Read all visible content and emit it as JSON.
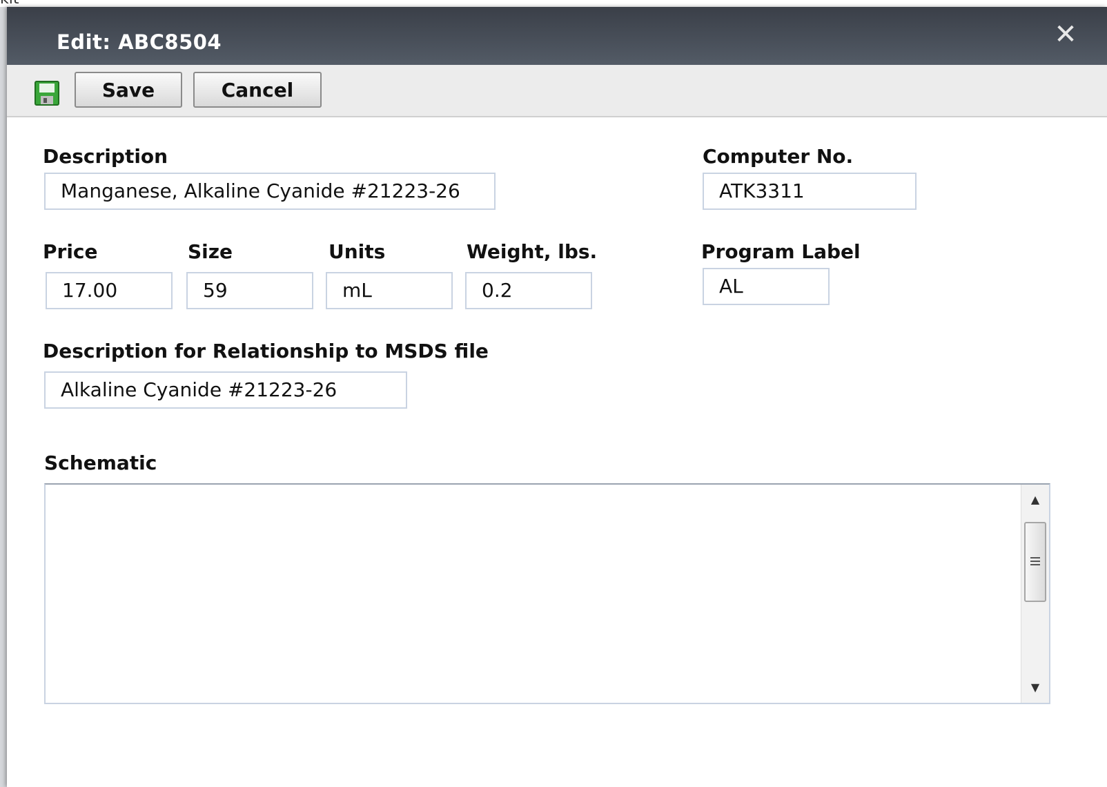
{
  "backdrop": {
    "partial_text": "kit"
  },
  "dialog": {
    "title": "Edit: ABC8504",
    "close_glyph": "✕"
  },
  "toolbar": {
    "save_icon": "floppy-disk-icon",
    "save_label": "Save",
    "cancel_label": "Cancel"
  },
  "form": {
    "description": {
      "label": "Description",
      "value": "Manganese, Alkaline Cyanide #21223-26"
    },
    "computer_no": {
      "label": "Computer No.",
      "value": "ATK3311"
    },
    "price": {
      "label": "Price",
      "value": "17.00"
    },
    "size": {
      "label": "Size",
      "value": "59"
    },
    "units": {
      "label": "Units",
      "value": "mL"
    },
    "weight": {
      "label": "Weight, lbs.",
      "value": "0.2"
    },
    "program_label": {
      "label": "Program Label",
      "value": "AL"
    },
    "msds_description": {
      "label": "Description for Relationship to MSDS file",
      "value": "Alkaline Cyanide #21223-26"
    },
    "schematic": {
      "label": "Schematic",
      "value": ""
    }
  },
  "scrollbar": {
    "up_glyph": "▲",
    "down_glyph": "▼"
  },
  "colors": {
    "titlebar": "#454b55",
    "field_border": "#c9d3e2",
    "save_icon_green": "#3aa63a"
  }
}
